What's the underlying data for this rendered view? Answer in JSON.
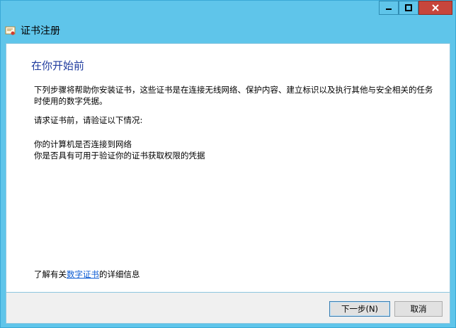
{
  "window": {
    "title": "证书注册",
    "controls": {
      "minimize": "—",
      "maximize": "□",
      "close": "✕"
    }
  },
  "page": {
    "heading": "在你开始前",
    "description": "下列步骤将帮助你安装证书，这些证书是在连接无线网络、保护内容、建立标识以及执行其他与安全相关的任务时使用的数字凭据。",
    "verify_intro": "请求证书前，请验证以下情况:",
    "checks": [
      "你的计算机是否连接到网络",
      "你是否具有可用于验证你的证书获取权限的凭据"
    ],
    "learn_more": {
      "prefix": "了解有关",
      "link": "数字证书",
      "suffix": "的详细信息"
    }
  },
  "buttons": {
    "next": "下一步(N)",
    "cancel": "取消"
  },
  "colors": {
    "titlebar": "#5fc5ea",
    "close_button": "#c7463c",
    "heading": "#1f3b9e",
    "link": "#0b5bd3"
  }
}
